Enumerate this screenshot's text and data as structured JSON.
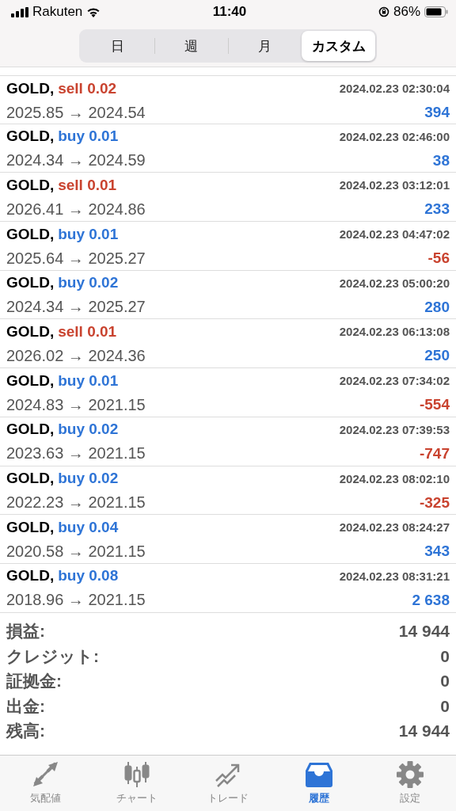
{
  "status_bar": {
    "carrier": "Rakuten",
    "time": "11:40",
    "battery": "86%"
  },
  "period_tabs": [
    {
      "label": "日",
      "selected": false
    },
    {
      "label": "週",
      "selected": false
    },
    {
      "label": "月",
      "selected": false
    },
    {
      "label": "カスタム",
      "selected": true
    }
  ],
  "deals": [
    {
      "symbol": "GOLD,",
      "kind": "sell",
      "volume": "sell 0.02",
      "time": "2024.02.23 02:30:04",
      "prices": "2025.85 → 2024.54",
      "profit": "394",
      "color": "#2e74d6"
    },
    {
      "symbol": "GOLD,",
      "kind": "buy",
      "volume": "buy 0.01",
      "time": "2024.02.23 02:46:00",
      "prices": "2024.34 → 2024.59",
      "profit": "38",
      "color": "#2e74d6"
    },
    {
      "symbol": "GOLD,",
      "kind": "sell",
      "volume": "sell 0.01",
      "time": "2024.02.23 03:12:01",
      "prices": "2026.41 → 2024.86",
      "profit": "233",
      "color": "#2e74d6"
    },
    {
      "symbol": "GOLD,",
      "kind": "buy",
      "volume": "buy 0.01",
      "time": "2024.02.23 04:47:02",
      "prices": "2025.64 → 2025.27",
      "profit": "-56",
      "color": "#c9432f"
    },
    {
      "symbol": "GOLD,",
      "kind": "buy",
      "volume": "buy 0.02",
      "time": "2024.02.23 05:00:20",
      "prices": "2024.34 → 2025.27",
      "profit": "280",
      "color": "#2e74d6"
    },
    {
      "symbol": "GOLD,",
      "kind": "sell",
      "volume": "sell 0.01",
      "time": "2024.02.23 06:13:08",
      "prices": "2026.02 → 2024.36",
      "profit": "250",
      "color": "#2e74d6"
    },
    {
      "symbol": "GOLD,",
      "kind": "buy",
      "volume": "buy 0.01",
      "time": "2024.02.23 07:34:02",
      "prices": "2024.83 → 2021.15",
      "profit": "-554",
      "color": "#c9432f"
    },
    {
      "symbol": "GOLD,",
      "kind": "buy",
      "volume": "buy 0.02",
      "time": "2024.02.23 07:39:53",
      "prices": "2023.63 → 2021.15",
      "profit": "-747",
      "color": "#c9432f"
    },
    {
      "symbol": "GOLD,",
      "kind": "buy",
      "volume": "buy 0.02",
      "time": "2024.02.23 08:02:10",
      "prices": "2022.23 → 2021.15",
      "profit": "-325",
      "color": "#c9432f"
    },
    {
      "symbol": "GOLD,",
      "kind": "buy",
      "volume": "buy 0.04",
      "time": "2024.02.23 08:24:27",
      "prices": "2020.58 → 2021.15",
      "profit": "343",
      "color": "#2e74d6"
    },
    {
      "symbol": "GOLD,",
      "kind": "buy",
      "volume": "buy 0.08",
      "time": "2024.02.23 08:31:21",
      "prices": "2018.96 → 2021.15",
      "profit": "2 638",
      "color": "#2e74d6"
    }
  ],
  "summary": [
    {
      "label": "損益:",
      "value": "14 944"
    },
    {
      "label": "クレジット:",
      "value": "0"
    },
    {
      "label": "証拠金:",
      "value": "0"
    },
    {
      "label": "出金:",
      "value": "0"
    },
    {
      "label": "残高:",
      "value": "14 944"
    }
  ],
  "tab_bar": [
    {
      "label": "気配値",
      "kind": "quotes",
      "selected": false
    },
    {
      "label": "チャート",
      "kind": "chart",
      "selected": false
    },
    {
      "label": "トレード",
      "kind": "trade",
      "selected": false
    },
    {
      "label": "履歴",
      "kind": "history",
      "selected": true
    },
    {
      "label": "設定",
      "kind": "settings",
      "selected": false
    }
  ]
}
